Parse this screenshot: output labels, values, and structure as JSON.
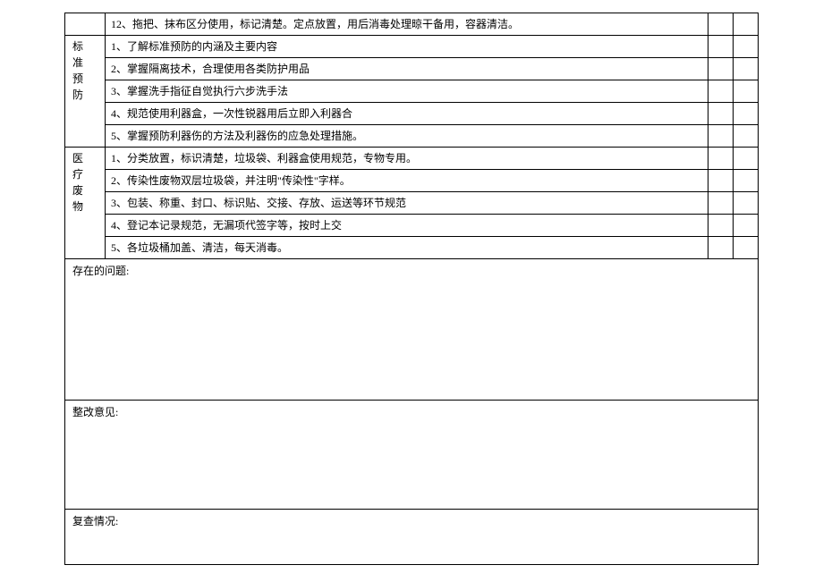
{
  "sections": {
    "s0_row12": "12、拖把、抹布区分使用，标记清楚。定点放置，用后消毒处理晾干备用，容器清洁。",
    "s1": {
      "label_lines": [
        "标",
        "准",
        "预",
        "防"
      ],
      "items": [
        "1、了解标准预防的内涵及主要内容",
        "2、掌握隔离技术，合理使用各类防护用品",
        "3、掌握洗手指征自觉执行六步洗手法",
        "4、规范使用利器盒，一次性锐器用后立即入利器合",
        "5、掌握预防利器伤的方法及利器伤的应急处理措施。"
      ]
    },
    "s2": {
      "label_lines": [
        "医",
        "疗",
        "废",
        "物"
      ],
      "items": [
        "1、分类放置，标识清楚，垃圾袋、利器盒使用规范，专物专用。",
        "2、传染性废物双层垃圾袋，并注明\"传染性\"字样。",
        "3、包装、称重、封口、标识贴、交接、存放、运送等环节规范",
        "4、登记本记录规范，无漏项代签字等，按时上交",
        "5、各垃圾桶加盖、清洁，每天消毒。"
      ]
    }
  },
  "freeform": {
    "issues_label": "存在的问题:",
    "opinion_label": "整改意见:",
    "recheck_label": "复查情况:"
  }
}
